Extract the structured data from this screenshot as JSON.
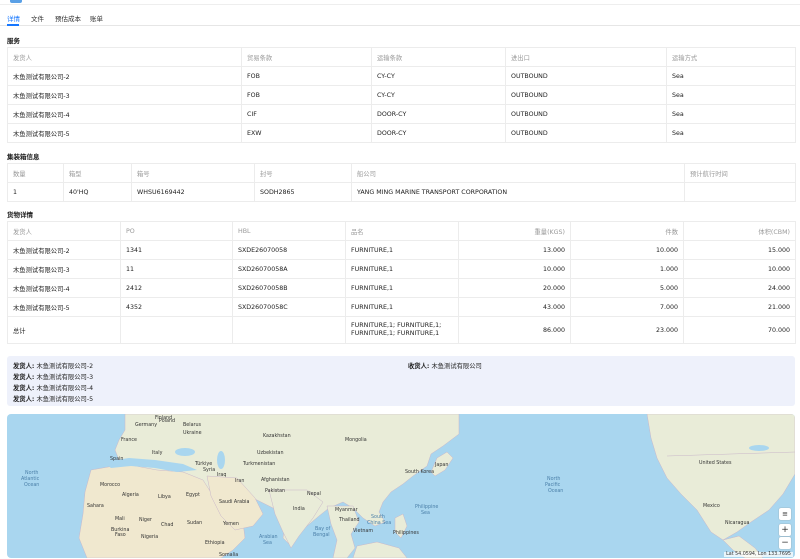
{
  "tabs": [
    "详情",
    "文件",
    "预估成本",
    "账单"
  ],
  "service": {
    "title": "服务",
    "headers": [
      "发货人",
      "贸易条款",
      "运输条款",
      "进出口",
      "运输方式"
    ],
    "rows": [
      [
        "木鱼测试有限公司-2",
        "FOB",
        "CY-CY",
        "OUTBOUND",
        "Sea"
      ],
      [
        "木鱼测试有限公司-3",
        "FOB",
        "CY-CY",
        "OUTBOUND",
        "Sea"
      ],
      [
        "木鱼测试有限公司-4",
        "CIF",
        "DOOR-CY",
        "OUTBOUND",
        "Sea"
      ],
      [
        "木鱼测试有限公司-5",
        "EXW",
        "DOOR-CY",
        "OUTBOUND",
        "Sea"
      ]
    ]
  },
  "container": {
    "title": "集装箱信息",
    "headers": [
      "数量",
      "箱型",
      "箱号",
      "封号",
      "船公司",
      "预计航行时间"
    ],
    "rows": [
      [
        "1",
        "40'HQ",
        "WHSU6169442",
        "SODH2865",
        "YANG MING MARINE TRANSPORT CORPORATION",
        ""
      ]
    ]
  },
  "cargo": {
    "title": "货物详情",
    "headers": [
      "发货人",
      "PO",
      "HBL",
      "品名",
      "重量(KGS)",
      "件数",
      "体积(CBM)"
    ],
    "rows": [
      [
        "木鱼测试有限公司-2",
        "1341",
        "SXDE26070058",
        "FURNITURE,1",
        "13.000",
        "10.000",
        "15.000"
      ],
      [
        "木鱼测试有限公司-3",
        "11",
        "SXD26070058A",
        "FURNITURE,1",
        "10.000",
        "1.000",
        "10.000"
      ],
      [
        "木鱼测试有限公司-4",
        "2412",
        "SXD26070058B",
        "FURNITURE,1",
        "20.000",
        "5.000",
        "24.000"
      ],
      [
        "木鱼测试有限公司-5",
        "4352",
        "SXD26070058C",
        "FURNITURE,1",
        "43.000",
        "7.000",
        "21.000"
      ]
    ],
    "total": {
      "label": "总计",
      "product_line1": "FURNITURE,1; FURNITURE,1;",
      "product_line2": "FURNITURE,1; FURNITURE,1",
      "weight": "86.000",
      "pieces": "23.000",
      "volume": "70.000"
    }
  },
  "parties": {
    "shipper_label": "发货人:",
    "shippers": [
      "木鱼测试有限公司-2",
      "木鱼测试有限公司-3",
      "木鱼测试有限公司-4",
      "木鱼测试有限公司-5"
    ],
    "consignee_label": "收货人:",
    "consignee": "木鱼测试有限公司"
  },
  "map": {
    "labels": {
      "finland": "Finland",
      "poland": "Poland",
      "germany": "Germany",
      "belarus": "Belarus",
      "ukraine": "Ukraine",
      "france": "France",
      "spain": "Spain",
      "italy": "Italy",
      "turkiye": "Türkiye",
      "kazakhstan": "Kazakhstan",
      "mongolia": "Mongolia",
      "uzbekistan": "Uzbekistan",
      "turkmenistan": "Turkmenistan",
      "afghanistan": "Afghanistan",
      "pakistan": "Pakistan",
      "iraq": "Iraq",
      "iran": "Iran",
      "syria": "Syria",
      "japan": "Japan",
      "south_korea": "South Korea",
      "nepal": "Nepal",
      "india": "India",
      "myanmar": "Myanmar",
      "thailand": "Thailand",
      "vietnam": "Vietnam",
      "philippines": "Philippines",
      "morocco": "Morocco",
      "algeria": "Algeria",
      "libya": "Libya",
      "egypt": "Egypt",
      "saudi_arabia": "Saudi Arabia",
      "mali": "Mali",
      "niger": "Niger",
      "chad": "Chad",
      "sudan": "Sudan",
      "yemen": "Yemen",
      "burkina": "Burkina",
      "faso": "Faso",
      "nigeria": "Nigeria",
      "ethiopia": "Ethiopia",
      "somalia": "Somalia",
      "sahara": "Sahara",
      "united_states": "United States",
      "mexico": "Mexico",
      "nicaragua": "Nicaragua",
      "north_atlantic_ocean": [
        "North",
        "Atlantic",
        "Ocean"
      ],
      "north_pacific_ocean": [
        "North",
        "Pacific",
        "Ocean"
      ],
      "bay_of_bengal": [
        "Bay of",
        "Bengal"
      ],
      "arabian_sea": [
        "Arabian",
        "Sea"
      ],
      "south_china_sea": [
        "South",
        "China Sea"
      ],
      "philippine_sea": [
        "Philippine",
        "Sea"
      ]
    },
    "zoom_in": "+",
    "zoom_out": "−",
    "coords": "Lat 54.0594, Lon 133.7695"
  },
  "colors": {
    "accent": "#1677ff",
    "land": "#e9ecd8",
    "water": "#a9d6ef",
    "desert": "#f0e8cf",
    "panel": "#eef1fb"
  }
}
